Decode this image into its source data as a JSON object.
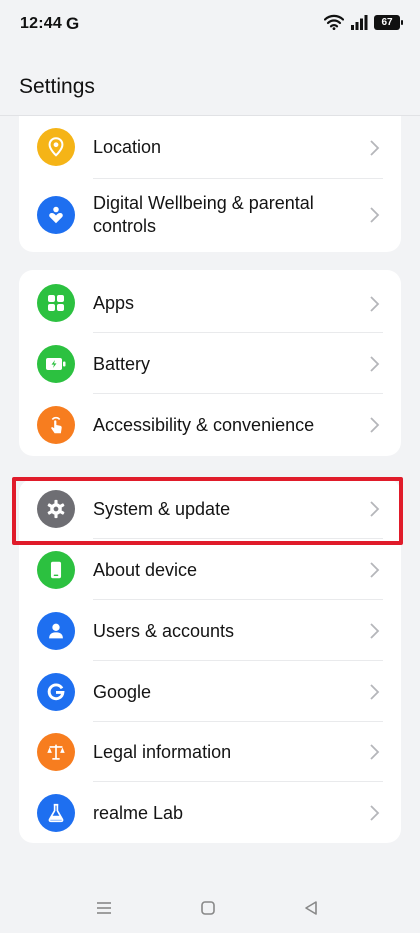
{
  "status_bar": {
    "time": "12:44",
    "carrier_icon": "G",
    "battery": "67"
  },
  "header": {
    "title": "Settings"
  },
  "groups": [
    {
      "items": [
        {
          "label": "Location",
          "icon": "location-icon",
          "color": "#f5b417"
        },
        {
          "label": "Digital Wellbeing & parental controls",
          "icon": "wellbeing-heart-icon",
          "color": "#1e6ff0"
        }
      ]
    },
    {
      "items": [
        {
          "label": "Apps",
          "icon": "apps-grid-icon",
          "color": "#2cc140"
        },
        {
          "label": "Battery",
          "icon": "battery-icon",
          "color": "#2cc140"
        },
        {
          "label": "Accessibility & convenience",
          "icon": "accessibility-hand-icon",
          "color": "#f77d1f"
        }
      ]
    },
    {
      "items": [
        {
          "label": "System & update",
          "icon": "gear-icon",
          "color": "#6e6e73"
        },
        {
          "label": "About device",
          "icon": "phone-icon",
          "color": "#2cc140"
        },
        {
          "label": "Users & accounts",
          "icon": "user-icon",
          "color": "#1e6ff0"
        },
        {
          "label": "Google",
          "icon": "google-icon",
          "color": "#1e6ff0"
        },
        {
          "label": "Legal information",
          "icon": "scales-icon",
          "color": "#f77d1f"
        },
        {
          "label": "realme Lab",
          "icon": "flask-icon",
          "color": "#1e6ff0"
        }
      ]
    }
  ],
  "colors": {
    "highlight": "#e01b2a",
    "background": "#f2f3f5"
  },
  "nav": {
    "icons": [
      "menu-icon",
      "home-icon",
      "back-icon"
    ]
  }
}
